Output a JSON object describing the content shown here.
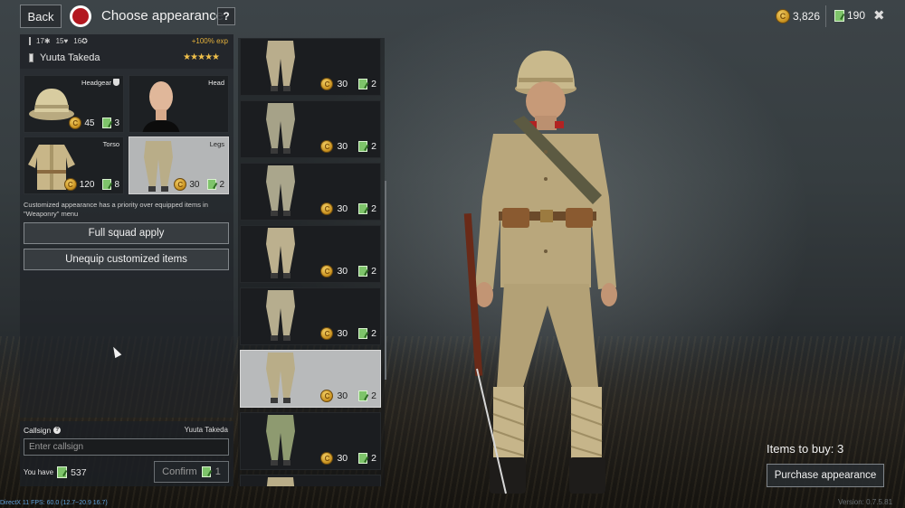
{
  "header": {
    "back_label": "Back",
    "title": "Choose appearance",
    "help_label": "?",
    "close_label": "✖",
    "gold": "3,826",
    "tickets": "190"
  },
  "soldier": {
    "stat1": "17",
    "stat2": "15",
    "stat3": "16",
    "exp_bonus": "+100% exp",
    "name": "Yuuta Takeda",
    "stars": "★★★★★"
  },
  "slots": [
    {
      "label": "Headgear",
      "gold": "45",
      "tickets": "3"
    },
    {
      "label": "Head"
    },
    {
      "label": "Torso",
      "gold": "120",
      "tickets": "8"
    },
    {
      "label": "Legs",
      "gold": "30",
      "tickets": "2"
    }
  ],
  "note": "Customized appearance has a priority over equipped items in \"Weaponry\" menu",
  "buttons": {
    "full_squad": "Full squad apply",
    "unequip": "Unequip customized items",
    "confirm": "Confirm",
    "purchase": "Purchase appearance"
  },
  "callsign": {
    "label": "Callsign",
    "help": "?",
    "name": "Yuuta Takeda",
    "placeholder": "Enter callsign",
    "you_have_label": "You have",
    "you_have_amount": "537",
    "confirm_tickets": "1"
  },
  "items": [
    {
      "gold": "30",
      "tickets": "2",
      "color": "#b9ad8c"
    },
    {
      "gold": "30",
      "tickets": "2",
      "color": "#a6a288"
    },
    {
      "gold": "30",
      "tickets": "2",
      "color": "#aaa68c"
    },
    {
      "gold": "30",
      "tickets": "2",
      "color": "#bcb08e"
    },
    {
      "gold": "30",
      "tickets": "2",
      "color": "#b6ad8e"
    },
    {
      "gold": "30",
      "tickets": "2",
      "color": "#b9ad88",
      "selected": true
    },
    {
      "gold": "30",
      "tickets": "2",
      "color": "#8e9a70"
    },
    {
      "gold": "",
      "tickets": "",
      "color": "#b9ad88"
    }
  ],
  "summary": {
    "items_to_buy": "Items to buy: 3",
    "version": "Version: 0.7.5.81",
    "fps": "DirectX 11 FPS: 60.0 (12.7~20.9 16.7)"
  },
  "colors": {
    "uniform": "#b9a77c",
    "helmet": "#c9b98c",
    "faction_red": "#b3171f",
    "ticket_green": "#7ec46a",
    "gold": "#e3b03b"
  }
}
